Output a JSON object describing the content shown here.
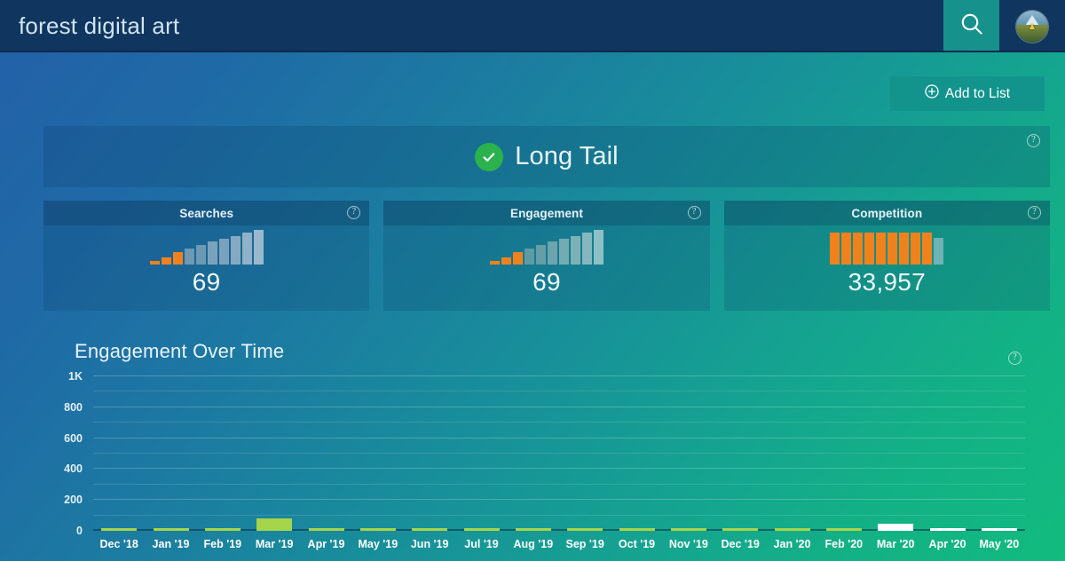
{
  "header": {
    "title": "forest digital art",
    "search_icon": "search-icon",
    "avatar_glyph": "▲"
  },
  "toolbar": {
    "add_to_list_label": "Add to List",
    "add_icon": "plus-circle-icon"
  },
  "banner": {
    "label": "Long Tail",
    "status_icon": "check-circle-icon",
    "help_icon": "help-circle-icon",
    "help_label": "?"
  },
  "cards": [
    {
      "title": "Searches",
      "value": "69",
      "help_label": "?",
      "bars": [
        {
          "h": 4,
          "color": "#f0821e"
        },
        {
          "h": 8,
          "color": "#f0821e"
        },
        {
          "h": 14,
          "color": "#f0821e"
        },
        {
          "h": 18,
          "color": "#6e98b4"
        },
        {
          "h": 22,
          "color": "#6e98b4"
        },
        {
          "h": 26,
          "color": "#7ba2bc"
        },
        {
          "h": 29,
          "color": "#7ba2bc"
        },
        {
          "h": 32,
          "color": "#86a9c1"
        },
        {
          "h": 36,
          "color": "#90b1c7"
        },
        {
          "h": 39,
          "color": "#9ab8cc"
        }
      ]
    },
    {
      "title": "Engagement",
      "value": "69",
      "help_label": "?",
      "bars": [
        {
          "h": 4,
          "color": "#f0821e"
        },
        {
          "h": 8,
          "color": "#f0821e"
        },
        {
          "h": 14,
          "color": "#f0821e"
        },
        {
          "h": 18,
          "color": "#5e9aa3"
        },
        {
          "h": 22,
          "color": "#649ea7"
        },
        {
          "h": 26,
          "color": "#6ca5ad"
        },
        {
          "h": 29,
          "color": "#74abb3"
        },
        {
          "h": 32,
          "color": "#7cb1b8"
        },
        {
          "h": 36,
          "color": "#85b8be"
        },
        {
          "h": 39,
          "color": "#8ebfc4"
        }
      ]
    },
    {
      "title": "Competition",
      "value": "33,957",
      "help_label": "?",
      "bars": [
        {
          "h": 36,
          "color": "#f0821e"
        },
        {
          "h": 36,
          "color": "#f0821e"
        },
        {
          "h": 36,
          "color": "#f0821e"
        },
        {
          "h": 36,
          "color": "#f0821e"
        },
        {
          "h": 36,
          "color": "#f0821e"
        },
        {
          "h": 36,
          "color": "#f0821e"
        },
        {
          "h": 36,
          "color": "#f0821e"
        },
        {
          "h": 36,
          "color": "#f0821e"
        },
        {
          "h": 36,
          "color": "#f0821e"
        },
        {
          "h": 30,
          "color": "#6fb3b5"
        }
      ]
    }
  ],
  "chart": {
    "title": "Engagement Over Time",
    "help_label": "?",
    "help_icon": "help-circle-icon"
  },
  "chart_data": {
    "type": "bar",
    "title": "Engagement Over Time",
    "xlabel": "",
    "ylabel": "",
    "ylim": [
      0,
      1000
    ],
    "grid": true,
    "legend": "none",
    "ytick_labels": [
      "0",
      "200",
      "400",
      "600",
      "800",
      "1K"
    ],
    "ytick_values": [
      0,
      200,
      400,
      600,
      800,
      1000
    ],
    "minor_gridline_step": 100,
    "categories": [
      "Dec '18",
      "Jan '19",
      "Feb '19",
      "Mar '19",
      "Apr '19",
      "May '19",
      "Jun '19",
      "Jul '19",
      "Aug '19",
      "Sep '19",
      "Oct '19",
      "Nov '19",
      "Dec '19",
      "Jan '20",
      "Feb '20",
      "Mar '20",
      "Apr '20",
      "May '20"
    ],
    "values": [
      14,
      14,
      14,
      80,
      12,
      12,
      12,
      12,
      12,
      12,
      12,
      12,
      12,
      12,
      12,
      45,
      10,
      10
    ],
    "bar_colors": [
      "#a6d44a",
      "#a6d44a",
      "#a6d44a",
      "#a6d44a",
      "#a6d44a",
      "#a6d44a",
      "#a6d44a",
      "#a6d44a",
      "#a6d44a",
      "#a6d44a",
      "#a6d44a",
      "#a6d44a",
      "#a6d44a",
      "#a6d44a",
      "#a6d44a",
      "#ffffff",
      "#ffffff",
      "#ffffff"
    ]
  },
  "theme": {
    "accent_teal": "#12948d",
    "accent_orange": "#f0821e",
    "accent_green": "#a6d44a",
    "status_green": "#2bb24c",
    "header_navy": "#10355e"
  }
}
